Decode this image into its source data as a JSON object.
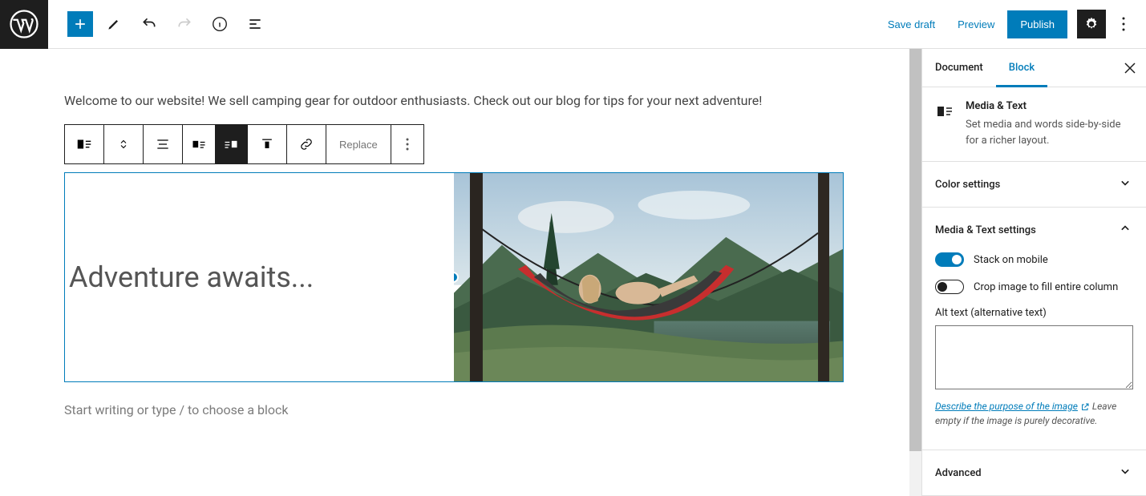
{
  "topbar": {
    "save_draft": "Save draft",
    "preview": "Preview",
    "publish": "Publish"
  },
  "editor": {
    "intro": "Welcome to our website! We sell camping gear for outdoor enthusiasts. Check out our blog for tips for your next adventure!",
    "block_toolbar": {
      "replace": "Replace"
    },
    "media_text": {
      "heading": "Adventure awaits..."
    },
    "placeholder": "Start writing or type / to choose a block"
  },
  "sidebar": {
    "tabs": {
      "document": "Document",
      "block": "Block"
    },
    "block_info": {
      "title": "Media & Text",
      "desc": "Set media and words side-by-side for a richer layout."
    },
    "panels": {
      "color": "Color settings",
      "media_text": "Media & Text settings",
      "advanced": "Advanced"
    },
    "settings": {
      "stack_mobile": "Stack on mobile",
      "crop_fill": "Crop image to fill entire column",
      "alt_label": "Alt text (alternative text)",
      "help_link": "Describe the purpose of the image",
      "help_tail": "Leave empty if the image is purely decorative."
    }
  }
}
